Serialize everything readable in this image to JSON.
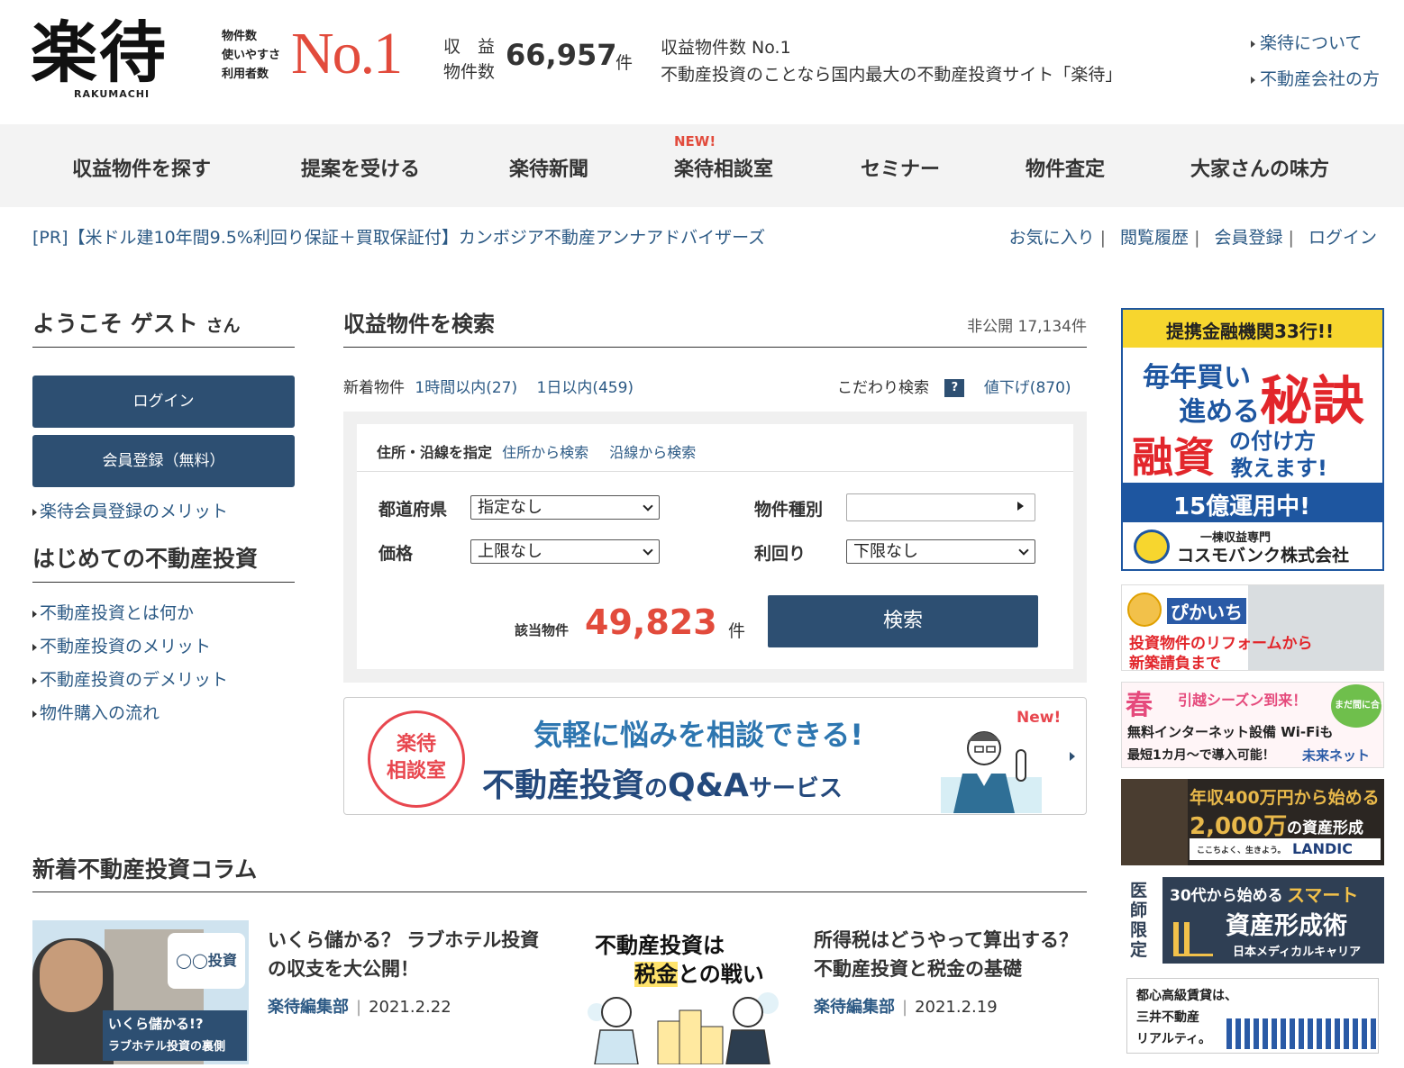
{
  "header": {
    "logo_kanji": "楽待",
    "logo_roman": "RAKUMACHI",
    "no1_labels": [
      "物件数",
      "使いやすさ",
      "利用者数"
    ],
    "no1_text": "No.1",
    "count_label_1": "収　益",
    "count_label_2": "物件数",
    "count_value": "66,957",
    "count_unit": "件",
    "tagline_1": "収益物件数 No.1",
    "tagline_2": "不動産投資のことなら国内最大の不動産投資サイト「楽待」",
    "links": [
      "楽待について",
      "不動産会社の方"
    ]
  },
  "gnav": {
    "items": [
      "収益物件を探す",
      "提案を受ける",
      "楽待新聞",
      "楽待相談室",
      "セミナー",
      "物件査定",
      "大家さんの味方"
    ],
    "new_badge": "NEW!"
  },
  "pr_text": "[PR]【米ドル建10年間9.5%利回り保証＋買取保証付】カンボジア不動産アンナアドバイザーズ",
  "user_links": [
    "お気に入り",
    "閲覧履歴",
    "会員登録",
    "ログイン"
  ],
  "user_link_sep": "|",
  "sidebar": {
    "welcome": "ようこそ ゲスト",
    "welcome_suffix": "さん",
    "login_button": "ログイン",
    "register_button": "会員登録（無料）",
    "merit_link": "楽待会員登録のメリット",
    "beginner_heading": "はじめての不動産投資",
    "beginner_links": [
      "不動産投資とは何か",
      "不動産投資のメリット",
      "不動産投資のデメリット",
      "物件購入の流れ"
    ]
  },
  "search": {
    "title": "収益物件を検索",
    "hidden_count": "非公開 17,134件",
    "new_label": "新着物件",
    "new_1h": "1時間以内(27)",
    "new_1d": "1日以内(459)",
    "advanced_label": "こだわり検索",
    "help_mark": "?",
    "price_down": "値下げ(870)",
    "tab_label": "住所・沿線を指定",
    "tab_address": "住所から検索",
    "tab_line": "沿線から検索",
    "pref_label": "都道府県",
    "pref_value": "指定なし",
    "type_label": "物件種別",
    "type_value": "",
    "price_label": "価格",
    "price_value": "上限なし",
    "yield_label": "利回り",
    "yield_value": "下限なし",
    "result_label": "該当物件",
    "result_count": "49,823",
    "result_unit": "件",
    "search_button": "検索"
  },
  "consult_banner": {
    "circle_1": "楽待",
    "circle_2": "相談室",
    "line1": "気軽に悩みを相談できる!",
    "line2_a": "不動産投資",
    "line2_b": "の",
    "line2_c": "Q&A",
    "line2_d": "サービス",
    "new_tag": "New!"
  },
  "columns": {
    "heading": "新着不動産投資コラム",
    "articles": [
      {
        "title": "いくら儲かる？ ラブホテル投資の収支を大公開！",
        "author": "楽待編集部",
        "date": "2021.2.22",
        "thumb_text_1": "いくら儲かる!?",
        "thumb_text_2": "ラブホテル投資の裏側",
        "thumb_text_3": "◯◯投資"
      },
      {
        "title": "所得税はどうやって算出する？ 不動産投資と税金の基礎",
        "author": "楽待編集部",
        "date": "2021.2.19",
        "thumb_text_1": "不動産投資は",
        "thumb_text_2": "税金",
        "thumb_text_3": "との戦い"
      }
    ]
  },
  "right_ads": {
    "ad1": {
      "top": "提携金融機関33行!!",
      "l1": "毎年買い",
      "l2": "進める",
      "big": "秘訣",
      "l3": "融資",
      "l4": "の付け方",
      "l5": "教えます!",
      "band": "15億運用中!",
      "sub": "一棟収益専門",
      "company": "コスモバンク株式会社"
    },
    "ad2": {
      "brand": "ぴかいち",
      "l1": "投資物件のリフォームから",
      "l2": "新築請負まで"
    },
    "ad3": {
      "spring": "春",
      "l1": "引越シーズン到来！",
      "l2": "無料インターネット設備 Wi-Fiも",
      "l3": "最短1カ月〜で導入可能！",
      "brand": "未来ネット",
      "bubble": "まだ間に合う"
    },
    "ad4": {
      "l1": "年収400万円から始める",
      "l2": "2,000万",
      "l3": "の資産形成",
      "brand": "LANDIC",
      "tag": "ここちよく、生きよう。"
    },
    "ad5": {
      "side": "医師限定",
      "l1": "30代から始める",
      "l1b": "スマート",
      "l2": "資産形成術",
      "brand": "日本メディカルキャリア"
    },
    "ad6": {
      "l1": "都心高級賃貸は、",
      "l2": "三井不動産",
      "l3": "リアルティ。"
    }
  },
  "colors": {
    "accent_red": "#e24b3c",
    "navy": "#2d4f72",
    "link": "#2c5a85"
  }
}
